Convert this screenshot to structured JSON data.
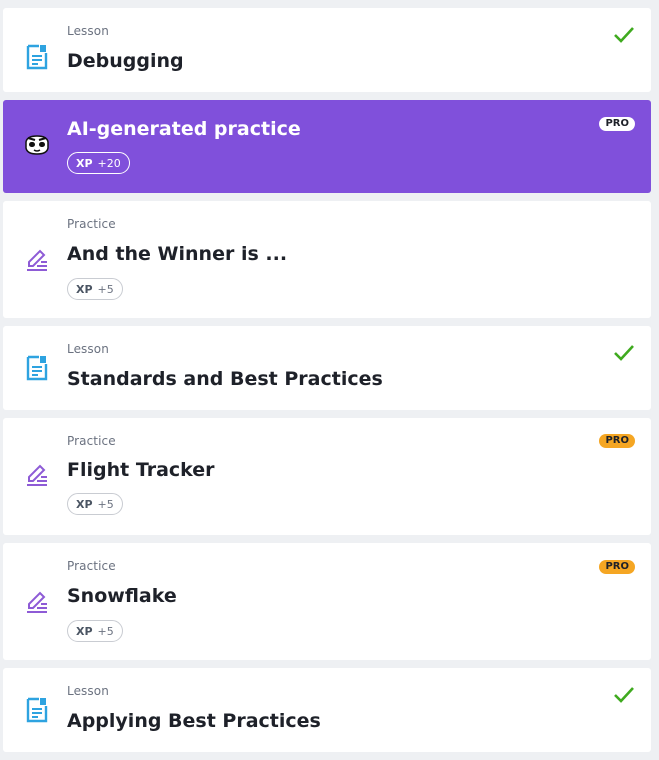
{
  "items": [
    {
      "type": "Lesson",
      "title": "Debugging",
      "completed": true,
      "icon": "lesson-document-icon"
    },
    {
      "type": "",
      "title": "AI-generated practice",
      "xp_label": "XP",
      "xp_value": "+20",
      "badge": "PRO",
      "icon": "ai-robot-face-icon"
    },
    {
      "type": "Practice",
      "title": "And the Winner is ...",
      "xp_label": "XP",
      "xp_value": "+5",
      "icon": "practice-pencil-icon"
    },
    {
      "type": "Lesson",
      "title": "Standards and Best Practices",
      "completed": true,
      "icon": "lesson-document-icon"
    },
    {
      "type": "Practice",
      "title": "Flight Tracker",
      "xp_label": "XP",
      "xp_value": "+5",
      "badge": "PRO",
      "icon": "practice-pencil-icon"
    },
    {
      "type": "Practice",
      "title": "Snowflake",
      "xp_label": "XP",
      "xp_value": "+5",
      "badge": "PRO",
      "icon": "practice-pencil-icon"
    },
    {
      "type": "Lesson",
      "title": "Applying Best Practices",
      "completed": true,
      "icon": "lesson-document-icon"
    }
  ],
  "colors": {
    "ai_background": "#8050db",
    "lesson_icon": "#2ea3e0",
    "practice_icon": "#8e5bd6",
    "check": "#3faa1f",
    "pro_badge": "#f5a623"
  }
}
